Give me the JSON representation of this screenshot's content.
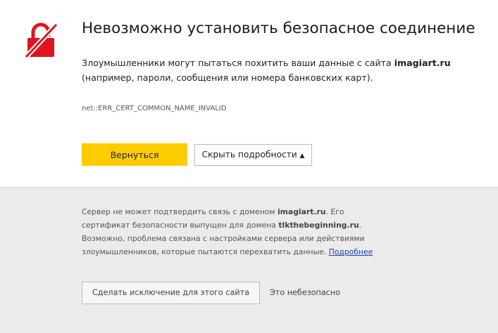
{
  "header": {
    "title": "Невозможно установить безопасное соединение",
    "description_pre": "Злоумышленники могут пытаться похитить ваши данные с сайта ",
    "site": "imagiart.ru",
    "description_post": "(например, пароли, сообщения или номера банковских карт).",
    "error_code": "net::ERR_CERT_COMMON_NAME_INVALID"
  },
  "actions": {
    "back_label": "Вернуться",
    "details_label": "Скрыть подробности",
    "details_arrow": "▲"
  },
  "details": {
    "line1_pre": "Сервер не может подтвердить связь с доменом ",
    "line1_domain": "imagiart.ru",
    "line1_post": ". Его сертификат безопасности выпущен для домена ",
    "cert_domain": "tlkthebeginning.ru",
    "line2_post": ". Возможно, проблема связана с настройками сервера или действиями злоумышленников, которые пытаются перехватить данные. ",
    "learn_more": "Подробнее"
  },
  "footer": {
    "exception_label": "Сделать исключение для этого сайта",
    "unsafe_note": "Это небезопасно"
  },
  "colors": {
    "accent": "#ffcc00",
    "lock_red": "#e0141e",
    "link": "#1a3dbd",
    "panel_bg": "#ebebeb"
  },
  "icons": {
    "lock": "broken-lock-icon"
  }
}
